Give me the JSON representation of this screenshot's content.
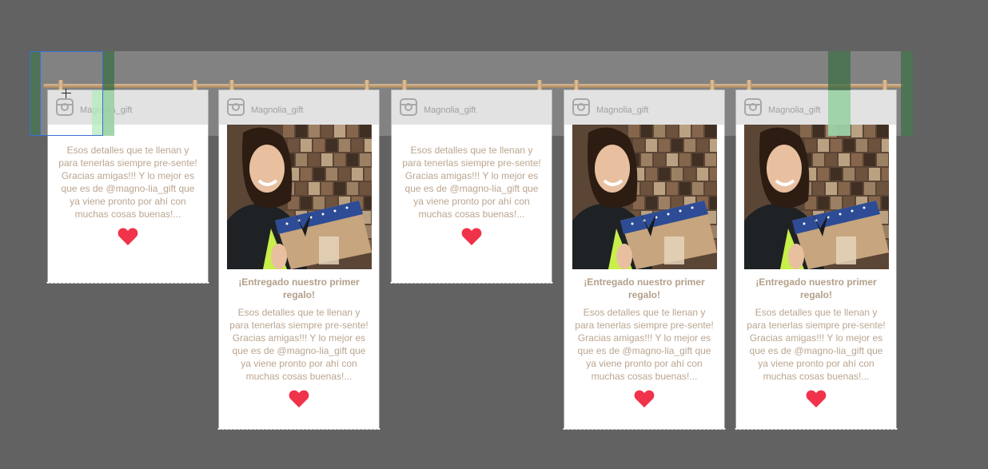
{
  "posts": [
    {
      "username": "Magnolia_gift",
      "has_photo": false,
      "title": "",
      "text": "Esos detalles que te llenan y para tenerlas siempre pre-sente! Gracias amigas!!! Y lo mejor es que es de @magno-lia_gift que ya viene pronto por ahí con muchas cosas buenas!..."
    },
    {
      "username": "Magnolia_gift",
      "has_photo": true,
      "title": "¡Entregado nuestro primer regalo!",
      "text": "Esos detalles que te llenan y para tenerlas siempre pre-sente! Gracias amigas!!! Y lo mejor es que es de @magno-lia_gift que ya viene pronto por ahí con muchas cosas buenas!..."
    },
    {
      "username": "Magnolia_gift",
      "has_photo": false,
      "title": "",
      "text": "Esos detalles que te llenan y para tenerlas siempre pre-sente! Gracias amigas!!! Y lo mejor es que es de @magno-lia_gift que ya viene pronto por ahí con muchas cosas buenas!..."
    },
    {
      "username": "Magnolia_gift",
      "has_photo": true,
      "title": "¡Entregado nuestro primer regalo!",
      "text": "Esos detalles que te llenan y para tenerlas siempre pre-sente! Gracias amigas!!! Y lo mejor es que es de @magno-lia_gift que ya viene pronto por ahí con muchas cosas buenas!..."
    },
    {
      "username": "Magnolia_gift",
      "has_photo": true,
      "title": "¡Entregado nuestro primer regalo!",
      "text": "Esos detalles que te llenan y para tenerlas siempre pre-sente! Gracias amigas!!! Y lo mejor es que es de @magno-lia_gift que ya viene pronto por ahí con muchas cosas buenas!..."
    }
  ],
  "icons": {
    "header": "instagram-icon",
    "like": "heart-icon"
  },
  "colors": {
    "background": "#626262",
    "heart": "#f0324a",
    "text": "#bba590",
    "header_band": "#e2e2e2"
  }
}
